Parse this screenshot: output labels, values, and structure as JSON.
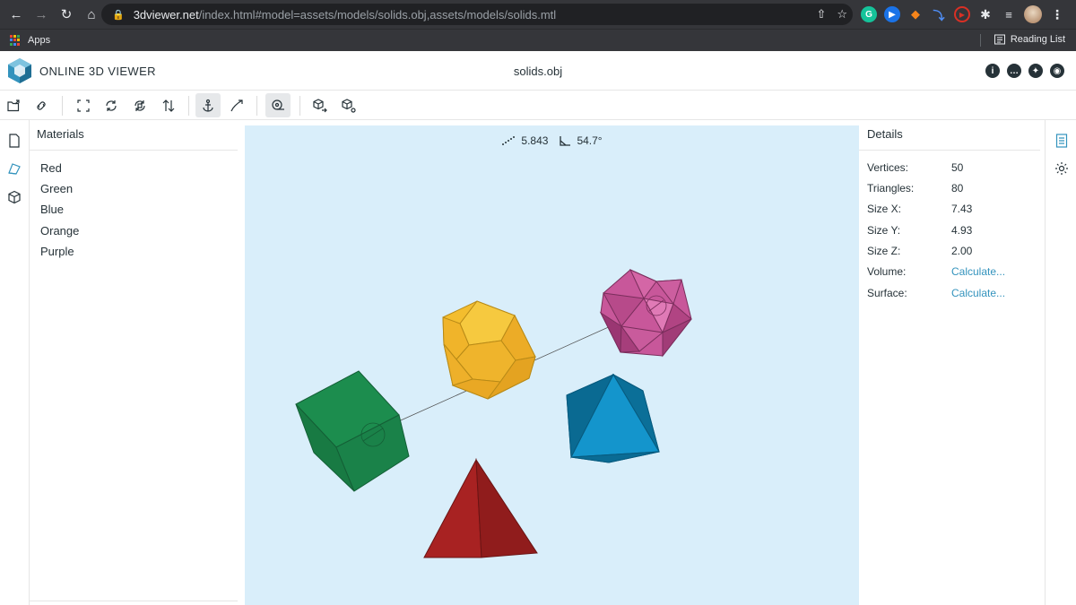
{
  "browser": {
    "url_host": "3dviewer.net",
    "url_path": "/index.html#model=assets/models/solids.obj,assets/models/solids.mtl",
    "bookmarks": {
      "apps_label": "Apps",
      "reading_list_label": "Reading List"
    },
    "extensions": [
      "grammarly-icon",
      "blue-circle-ext-icon",
      "metamask-fox-icon",
      "blue-arrow-ext-icon",
      "red-play-ext-icon",
      "puzzle-icon",
      "media-queue-icon"
    ]
  },
  "app": {
    "logo_text": "ONLINE 3D VIEWER",
    "file_title": "solids.obj",
    "header_icons": [
      "info-icon",
      "feedback-icon",
      "twitter-icon",
      "github-icon"
    ]
  },
  "toolbar": {
    "buttons": [
      "open-file",
      "open-url",
      "fit-to-window",
      "set-up-vector-y",
      "set-up-vector-z",
      "flip-up-vector",
      "fixed-up-vector",
      "free-orbit",
      "measure",
      "export",
      "share"
    ],
    "active": [
      "fixed-up-vector",
      "measure"
    ]
  },
  "materials": {
    "title": "Materials",
    "items": [
      {
        "label": "Red",
        "color": "#8e1c1c"
      },
      {
        "label": "Green",
        "color": "#1c7f46"
      },
      {
        "label": "Blue",
        "color": "#0c82b2"
      },
      {
        "label": "Orange",
        "color": "#f0b832"
      },
      {
        "label": "Purple",
        "color": "#c04f8e"
      }
    ]
  },
  "measure": {
    "distance": "5.843",
    "angle": "54.7°"
  },
  "details": {
    "title": "Details",
    "rows": [
      {
        "label": "Vertices:",
        "value": "50"
      },
      {
        "label": "Triangles:",
        "value": "80"
      },
      {
        "label": "Size X:",
        "value": "7.43"
      },
      {
        "label": "Size Y:",
        "value": "4.93"
      },
      {
        "label": "Size Z:",
        "value": "2.00"
      },
      {
        "label": "Volume:",
        "value": "Calculate..."
      },
      {
        "label": "Surface:",
        "value": "Calculate..."
      }
    ]
  },
  "colors": {
    "accent": "#3393bd",
    "viewport_bg": "#d9eefa",
    "chrome_dark": "#35363a"
  }
}
